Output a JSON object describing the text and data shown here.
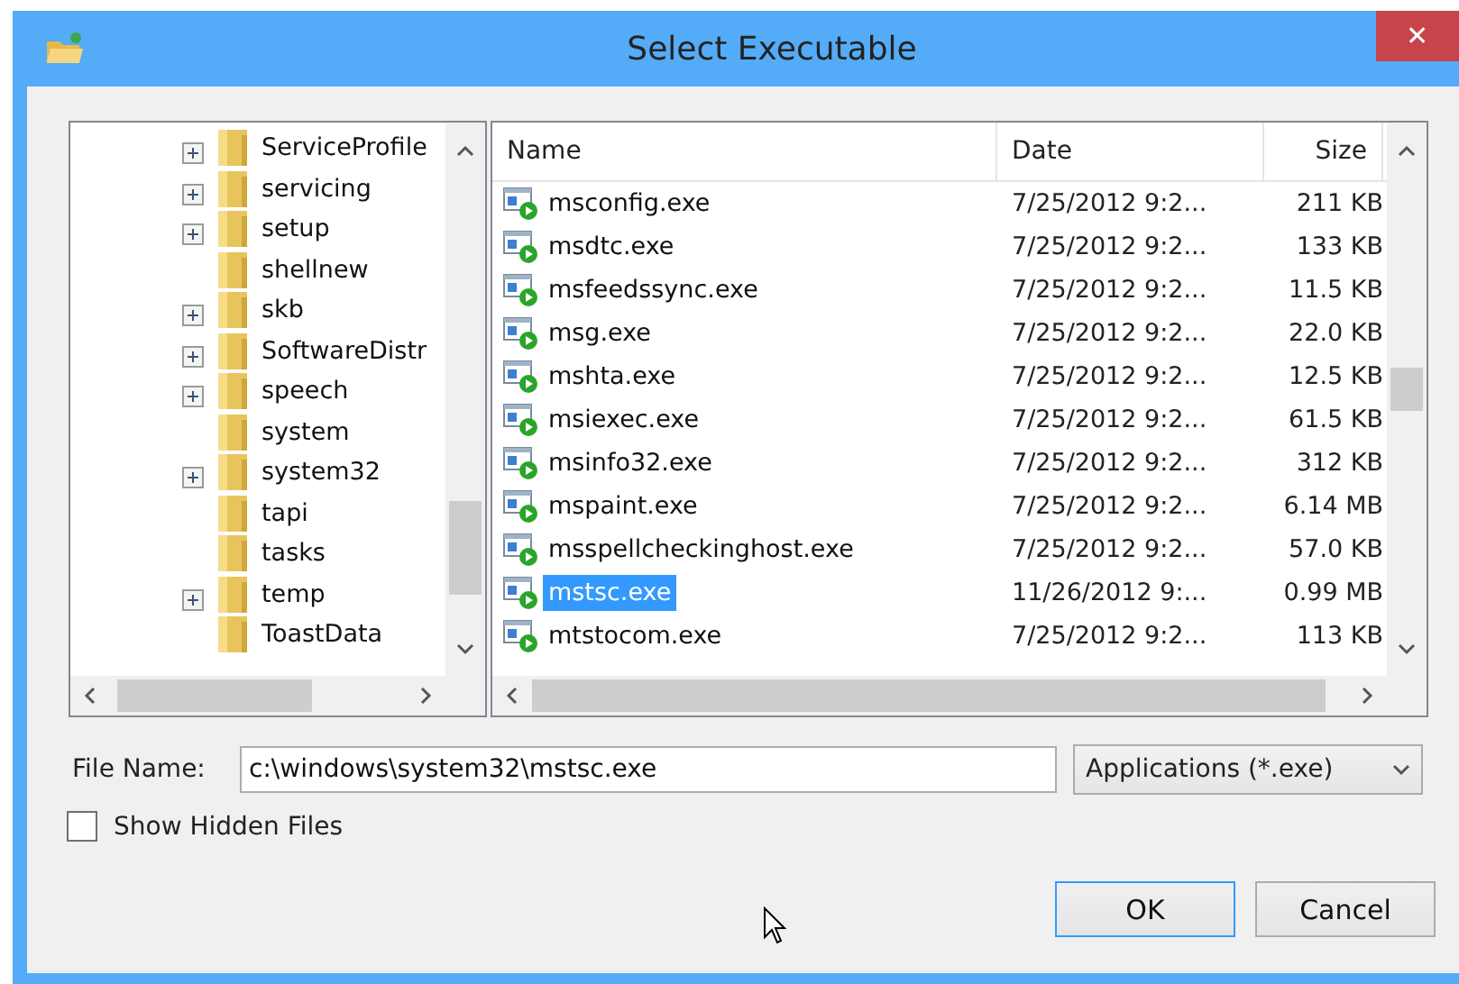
{
  "window": {
    "title": "Select Executable",
    "close_label": "✕"
  },
  "tree": {
    "items": [
      {
        "label": "ServiceProfile",
        "has_children": true,
        "expanded": false
      },
      {
        "label": "servicing",
        "has_children": true,
        "expanded": false
      },
      {
        "label": "setup",
        "has_children": true,
        "expanded": false
      },
      {
        "label": "shellnew",
        "has_children": false
      },
      {
        "label": "skb",
        "has_children": true,
        "expanded": false
      },
      {
        "label": "SoftwareDistr",
        "has_children": true,
        "expanded": false
      },
      {
        "label": "speech",
        "has_children": true,
        "expanded": false
      },
      {
        "label": "system",
        "has_children": false
      },
      {
        "label": "system32",
        "has_children": true,
        "expanded": false
      },
      {
        "label": "tapi",
        "has_children": false
      },
      {
        "label": "tasks",
        "has_children": false
      },
      {
        "label": "temp",
        "has_children": true,
        "expanded": false
      },
      {
        "label": "ToastData",
        "has_children": false
      }
    ]
  },
  "file_list": {
    "columns": [
      "Name",
      "Date",
      "Size"
    ],
    "rows": [
      {
        "name": "msconfig.exe",
        "date": "7/25/2012 9:2...",
        "size": "211 KB",
        "selected": false
      },
      {
        "name": "msdtc.exe",
        "date": "7/25/2012 9:2...",
        "size": "133 KB",
        "selected": false
      },
      {
        "name": "msfeedssync.exe",
        "date": "7/25/2012 9:2...",
        "size": "11.5 KB",
        "selected": false
      },
      {
        "name": "msg.exe",
        "date": "7/25/2012 9:2...",
        "size": "22.0 KB",
        "selected": false
      },
      {
        "name": "mshta.exe",
        "date": "7/25/2012 9:2...",
        "size": "12.5 KB",
        "selected": false
      },
      {
        "name": "msiexec.exe",
        "date": "7/25/2012 9:2...",
        "size": "61.5 KB",
        "selected": false
      },
      {
        "name": "msinfo32.exe",
        "date": "7/25/2012 9:2...",
        "size": "312 KB",
        "selected": false
      },
      {
        "name": "mspaint.exe",
        "date": "7/25/2012 9:2...",
        "size": "6.14 MB",
        "selected": false
      },
      {
        "name": "msspellcheckinghost.exe",
        "date": "7/25/2012 9:2...",
        "size": "57.0 KB",
        "selected": false
      },
      {
        "name": "mstsc.exe",
        "date": "11/26/2012 9:...",
        "size": "0.99 MB",
        "selected": true
      },
      {
        "name": "mtstocom.exe",
        "date": "7/25/2012 9:2...",
        "size": "113 KB",
        "selected": false
      }
    ]
  },
  "file_name": {
    "label": "File Name:",
    "value": "c:\\windows\\system32\\mstsc.exe"
  },
  "file_type": {
    "value": "Applications (*.exe)"
  },
  "show_hidden": {
    "label": "Show Hidden Files",
    "checked": false
  },
  "buttons": [
    {
      "label": "OK",
      "default": true
    },
    {
      "label": "Cancel",
      "default": false
    }
  ]
}
